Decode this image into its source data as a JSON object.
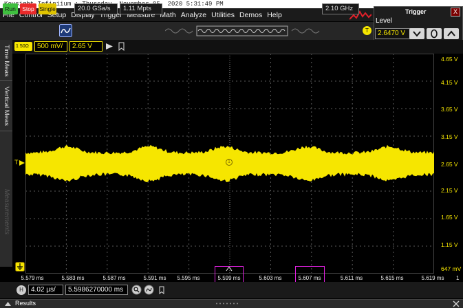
{
  "window": {
    "title": "Keysight Infiniium : Thursday, November 05, 2020 5:31:49 PM"
  },
  "menu": [
    "File",
    "Control",
    "Setup",
    "Display",
    "Trigger",
    "Measure",
    "Math",
    "Analyze",
    "Utilities",
    "Demos",
    "Help"
  ],
  "toolbar": {
    "run_label": "Run",
    "stop_label": "Stop",
    "single_label": "Single",
    "sample_rate": "20.0 GSa/s",
    "memory_depth": "1.11 Mpts",
    "bandwidth": "2.10 GHz",
    "trigger_badge": "T"
  },
  "trigger_panel": {
    "title": "Trigger",
    "close_label": "X",
    "level_label": "Level",
    "level_value": "2.6470 V"
  },
  "channel": {
    "number": "1",
    "impedance": "50Ω",
    "scale": "500 mV/",
    "offset": "2.65 V"
  },
  "left_tabs": {
    "time_meas": "Time Meas",
    "vertical_meas": "Vertical Meas",
    "measurements": "Measurements"
  },
  "plot": {
    "trigger_marker": "T",
    "channel_marker": "1",
    "ground_marker": "1",
    "y_labels": [
      "4.65 V",
      "4.15 V",
      "3.65 V",
      "3.15 V",
      "2.65 V",
      "2.15 V",
      "1.65 V",
      "1.15 V",
      "647 mV"
    ],
    "x_labels": [
      "5.579 ms",
      "5.583 ms",
      "5.587 ms",
      "5.591 ms",
      "5.595 ms",
      "5.599 ms",
      "5.603 ms",
      "5.607 ms",
      "5.611 ms",
      "5.615 ms",
      "5.619 ms"
    ],
    "x_right_marker": "1",
    "highlighted_x": [
      "5.599 ms",
      "5.607 ms"
    ],
    "trace_color": "#f6e600",
    "highlight_color": "#e020e0"
  },
  "timebase": {
    "horizontal_badge": "H",
    "scale": "4.02 µs/",
    "position": "5.5986270000 ms"
  },
  "results": {
    "label": "Results"
  }
}
